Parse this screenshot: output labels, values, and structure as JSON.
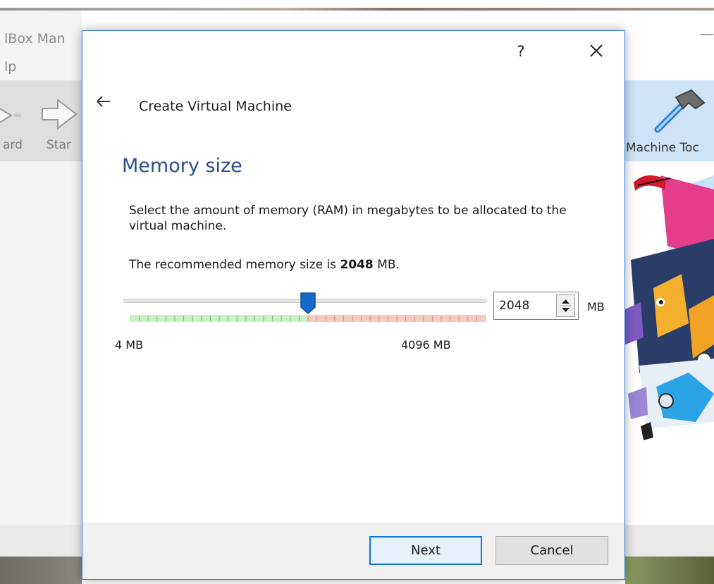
{
  "background": {
    "app_title": "lBox Man",
    "menu": "lp",
    "toolbar": {
      "wizard_label": "ard",
      "start_label": "Star",
      "tools_label": "Machine Toc"
    },
    "minimize_glyph": "—"
  },
  "dialog": {
    "help_label": "?",
    "title": "Create Virtual Machine",
    "page_title": "Memory size",
    "description": "Select the amount of memory (RAM) in megabytes to be allocated to the virtual machine.",
    "recommend_prefix": "The recommended memory size is ",
    "recommend_value": "2048",
    "recommend_suffix": " MB.",
    "slider": {
      "min": 4,
      "max": 4096,
      "value": 2048,
      "min_label": "4 MB",
      "max_label": "4096 MB"
    },
    "memory_input": {
      "value": "2048",
      "unit": "MB"
    },
    "buttons": {
      "next": "Next",
      "cancel": "Cancel"
    }
  },
  "colors": {
    "accent": "#0f76d7",
    "heading": "#2b4f8a",
    "scale_safe": "#c8f2c3",
    "scale_risky": "#f7c9c2",
    "thumb": "#1668c9"
  }
}
